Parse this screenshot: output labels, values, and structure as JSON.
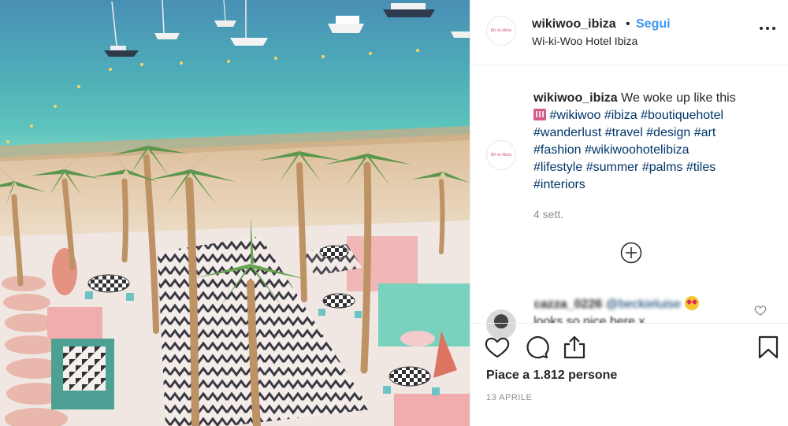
{
  "post": {
    "account": "wikiwoo_ibiza",
    "separator": "•",
    "follow_label": "Segui",
    "location": "Wi-ki-Woo Hotel Ibiza",
    "avatar_text": "Wi-ki-Woo",
    "more_icon": "more-options-icon"
  },
  "caption": {
    "user": "wikiwoo_ibiza",
    "text": "We woke up like this",
    "emoji": "hotel-emoji",
    "hashtags": [
      "#wikiwoo",
      "#ibiza",
      "#boutiquehotel",
      "#wanderlust",
      "#travel",
      "#design",
      "#art",
      "#fashion",
      "#wikiwoohotelibiza",
      "#lifestyle",
      "#summer",
      "#palms",
      "#tiles",
      "#interiors"
    ],
    "time_ago": "4 sett."
  },
  "comment": {
    "user": "cazza_0226",
    "mention": "@beckieluise",
    "text": "looks so nice here x",
    "emoji": "heart-eyes-emoji"
  },
  "actions": {
    "like_icon": "heart-icon",
    "comment_icon": "comment-icon",
    "share_icon": "share-icon",
    "save_icon": "bookmark-icon"
  },
  "likes": "Piace a 1.812 persone",
  "date": "13 APRILE",
  "colors": {
    "link_blue": "#3897f0",
    "hashtag": "#003569",
    "muted": "#8e8e8e",
    "text": "#262626",
    "divider": "#efefef"
  }
}
